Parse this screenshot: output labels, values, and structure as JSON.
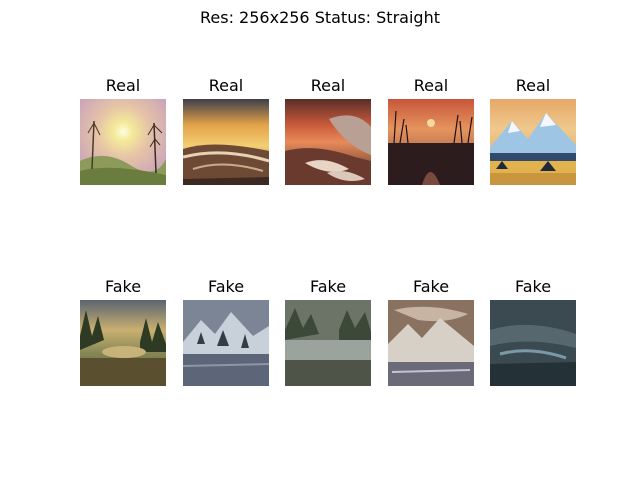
{
  "figure": {
    "title": "Res: 256x256  Status: Straight"
  },
  "rows": [
    {
      "label": "Real",
      "tiles": [
        {
          "label": "Real",
          "icon": "sunset-hills-painting"
        },
        {
          "label": "Real",
          "icon": "golden-sea-painting"
        },
        {
          "label": "Real",
          "icon": "red-wave-painting"
        },
        {
          "label": "Real",
          "icon": "marsh-sunset-painting"
        },
        {
          "label": "Real",
          "icon": "blue-mountains-painting"
        }
      ]
    },
    {
      "label": "Fake",
      "tiles": [
        {
          "label": "Fake",
          "icon": "generated-forest-lake"
        },
        {
          "label": "Fake",
          "icon": "generated-snowy-peaks"
        },
        {
          "label": "Fake",
          "icon": "generated-misty-lake"
        },
        {
          "label": "Fake",
          "icon": "generated-glacier-scene"
        },
        {
          "label": "Fake",
          "icon": "generated-dark-seascape"
        }
      ]
    }
  ]
}
